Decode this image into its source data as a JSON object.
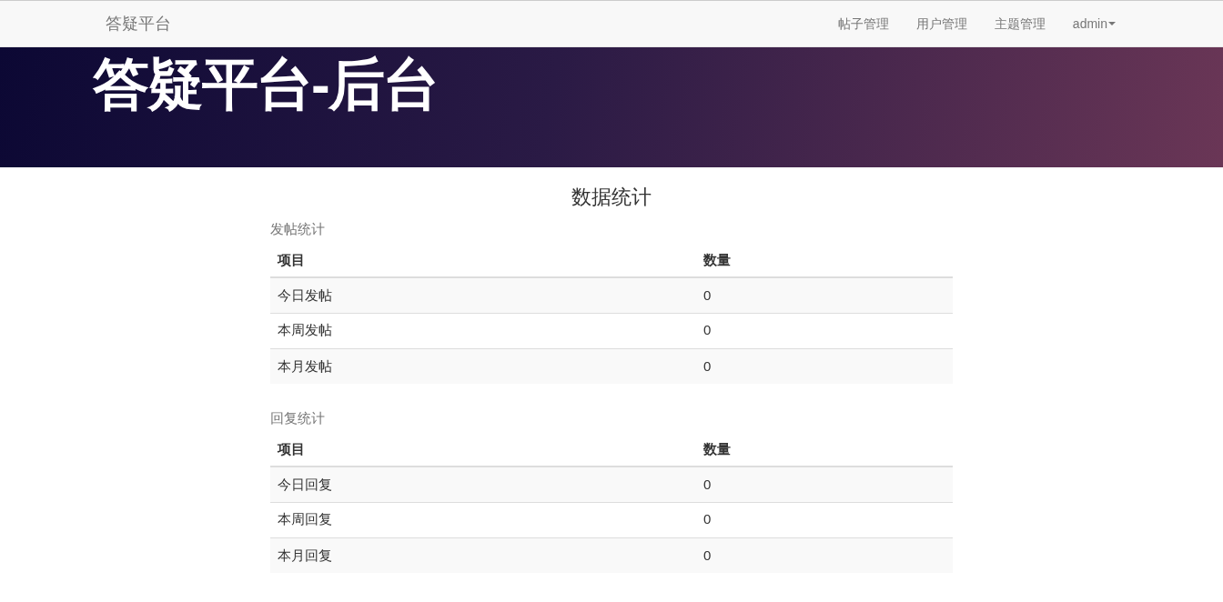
{
  "navbar": {
    "brand": "答疑平台",
    "links": [
      {
        "label": "帖子管理",
        "kind": "link"
      },
      {
        "label": "用户管理",
        "kind": "link"
      },
      {
        "label": "主题管理",
        "kind": "link"
      },
      {
        "label": "admin",
        "kind": "dropdown"
      }
    ]
  },
  "hero": {
    "title": "答疑平台-后台"
  },
  "page_title": "数据统计",
  "sections": [
    {
      "caption": "发帖统计",
      "columns": [
        "项目",
        "数量"
      ],
      "rows": [
        [
          "今日发帖",
          "0"
        ],
        [
          "本周发帖",
          "0"
        ],
        [
          "本月发帖",
          "0"
        ]
      ]
    },
    {
      "caption": "回复统计",
      "columns": [
        "项目",
        "数量"
      ],
      "rows": [
        [
          "今日回复",
          "0"
        ],
        [
          "本周回复",
          "0"
        ],
        [
          "本月回复",
          "0"
        ]
      ]
    }
  ]
}
